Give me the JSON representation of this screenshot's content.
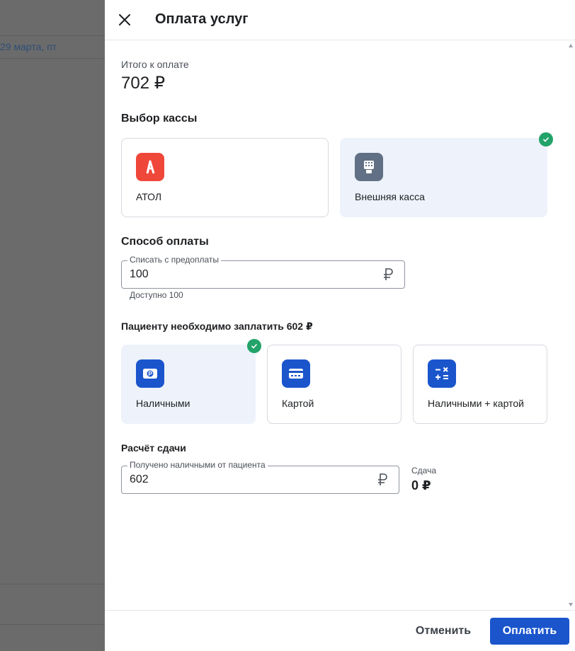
{
  "backdrop": {
    "date_text": "29 марта, пт"
  },
  "dialog": {
    "title": "Оплата услуг",
    "total": {
      "label": "Итого к оплате",
      "value": "702 ₽"
    },
    "register_section": {
      "title": "Выбор кассы",
      "options": [
        {
          "label": "АТОЛ",
          "icon": "atol-logo-icon",
          "icon_color": "#f0473b",
          "selected": false
        },
        {
          "label": "Внешняя касса",
          "icon": "cash-register-icon",
          "icon_color": "#617085",
          "selected": true
        }
      ]
    },
    "payment_section": {
      "title": "Способ оплаты",
      "prepayment_field": {
        "label": "Списать с предоплаты",
        "value": "100",
        "currency": "₽"
      },
      "available_hint": "Доступно 100",
      "patient_pays": "Пациенту необходимо заплатить 602 ₽",
      "methods": [
        {
          "label": "Наличными",
          "icon": "cash-icon",
          "selected": true
        },
        {
          "label": "Картой",
          "icon": "card-icon",
          "selected": false
        },
        {
          "label": "Наличными + картой",
          "icon": "calculator-icon",
          "selected": false
        }
      ],
      "method_icon_color": "#1a55cc"
    },
    "change_section": {
      "title": "Расчёт сдачи",
      "cash_field": {
        "label": "Получено наличными от пациента",
        "value": "602",
        "currency": "₽"
      },
      "change_label": "Сдача",
      "change_value": "0 ₽"
    },
    "footer": {
      "cancel_label": "Отменить",
      "pay_label": "Оплатить"
    },
    "colors": {
      "accent": "#1a55cc",
      "selected_bg": "#edf2fb",
      "check": "#23a36a"
    }
  }
}
